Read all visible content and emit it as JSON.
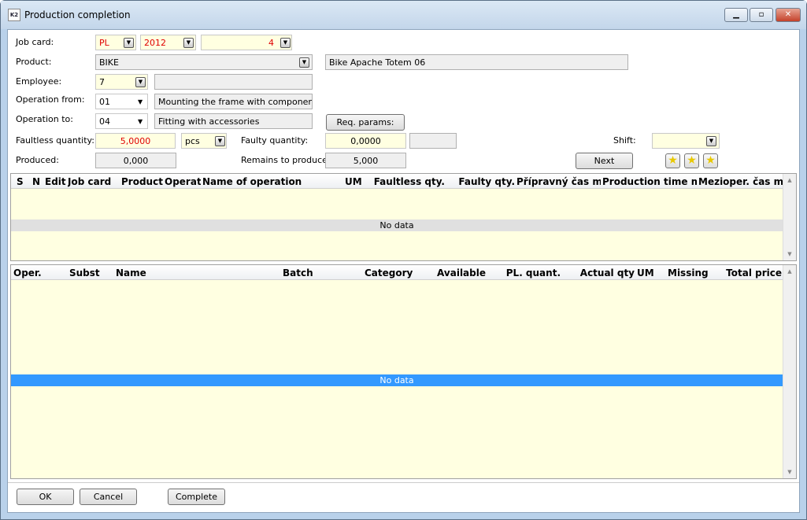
{
  "window": {
    "title": "Production completion",
    "buttons": [
      "minimize",
      "maximize",
      "close"
    ]
  },
  "form": {
    "job_card": {
      "label": "Job card:",
      "prefix": "PL",
      "year": "2012",
      "number": "4"
    },
    "product": {
      "label": "Product:",
      "code": "BIKE",
      "name": "Bike Apache Totem 06"
    },
    "employee": {
      "label": "Employee:",
      "value": "7",
      "name": ""
    },
    "operation_from": {
      "label": "Operation from:",
      "value": "01",
      "name": "Mounting the frame with components"
    },
    "operation_to": {
      "label": "Operation to:",
      "value": "04",
      "name": "Fitting with accessories"
    },
    "req_params": "Req. params:",
    "faultless_qty": {
      "label": "Faultless quantity:",
      "value": "5,0000",
      "unit": "pcs"
    },
    "faulty_qty": {
      "label": "Faulty quantity:",
      "value": "0,0000",
      "extra": ""
    },
    "shift": {
      "label": "Shift:",
      "value": ""
    },
    "produced": {
      "label": "Produced:",
      "value": "0,000"
    },
    "remains": {
      "label": "Remains to produce:",
      "value": "5,000"
    },
    "next": "Next",
    "favorites_icons": [
      "star-icon",
      "star-add-icon",
      "star-remove-icon"
    ]
  },
  "grid_operations": {
    "columns": [
      "S",
      "N",
      "Edit",
      "Job card",
      "Product",
      "Operat",
      "Name of operation",
      "UM",
      "Faultless qty.",
      "Faulty qty.",
      "Přípravný čas m",
      "Production time m",
      "Mezioper. čas m"
    ],
    "empty_text": "No data"
  },
  "grid_materials": {
    "columns": [
      "Oper.",
      "Subst",
      "Name",
      "Batch",
      "Category",
      "Available",
      "PL. quant.",
      "Actual qty",
      "UM",
      "Missing",
      "Total price"
    ],
    "empty_text": "No data"
  },
  "footer": {
    "ok": "OK",
    "cancel": "Cancel",
    "complete": "Complete"
  },
  "colors": {
    "required_field": "#ffffe1",
    "selected_row": "#3399ff",
    "red_text": "#e00000"
  }
}
